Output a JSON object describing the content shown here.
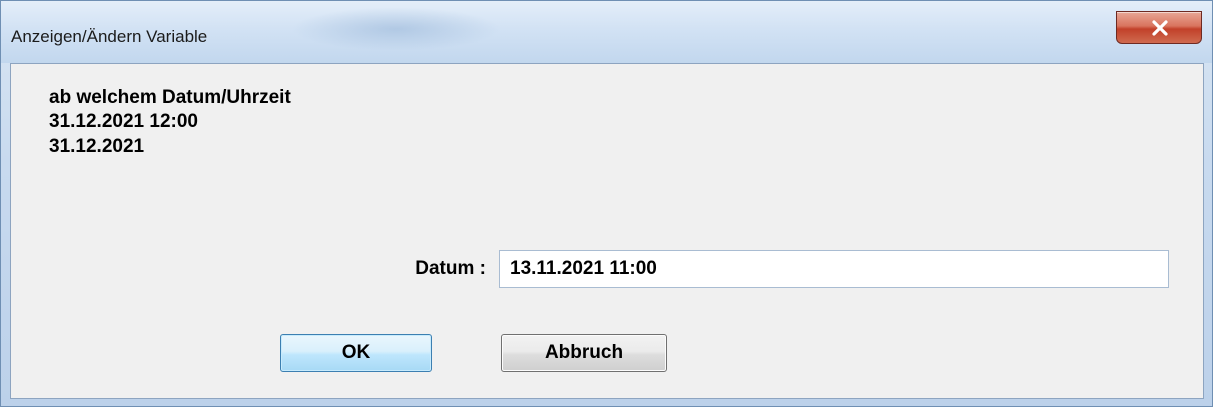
{
  "window": {
    "title": "Anzeigen/Ändern Variable"
  },
  "message": {
    "line1": "ab welchem Datum/Uhrzeit",
    "line2": "31.12.2021 12:00",
    "line3": "31.12.2021"
  },
  "form": {
    "datum_label": "Datum :",
    "datum_value": "13.11.2021 11:00"
  },
  "buttons": {
    "ok_label": "OK",
    "cancel_label": "Abbruch"
  },
  "icons": {
    "close": "close-x-icon"
  },
  "colors": {
    "close_button": "#c7432c",
    "ok_button_border": "#3c7fb1",
    "client_background": "#f0f0f0"
  }
}
